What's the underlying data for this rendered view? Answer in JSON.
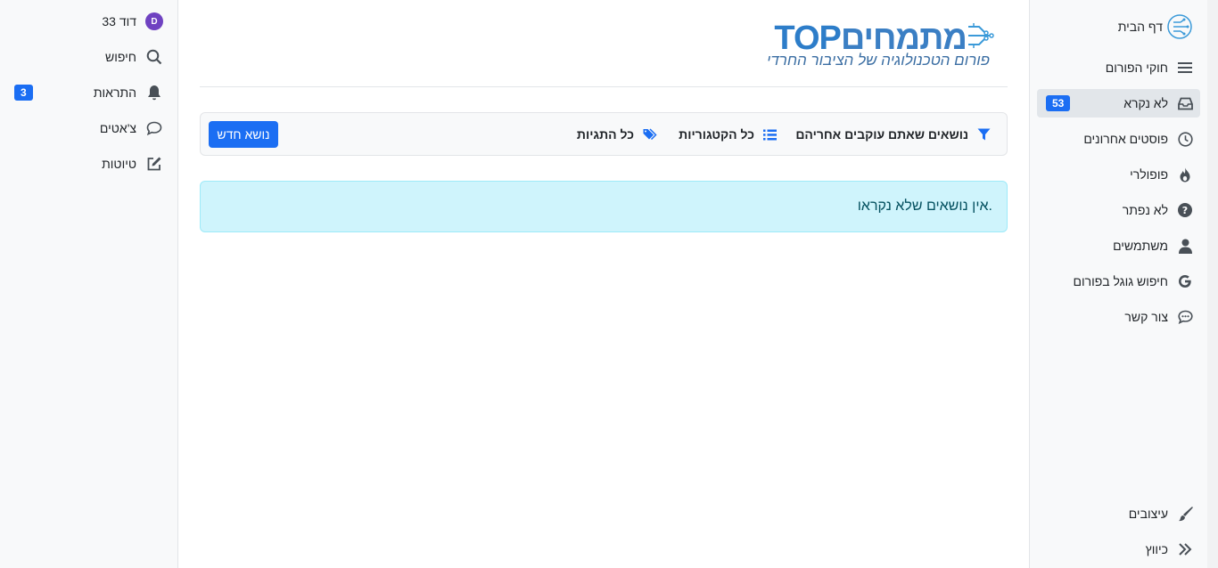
{
  "right_sidebar": {
    "items": [
      {
        "label": "דף הבית",
        "icon": "brain-circuit-icon"
      },
      {
        "label": "חוקי הפורום",
        "icon": "menu-lines-icon"
      },
      {
        "label": "לא נקרא",
        "icon": "inbox-icon",
        "badge": "53",
        "active": true
      },
      {
        "label": "פוסטים אחרונים",
        "icon": "clock-icon"
      },
      {
        "label": "פופולרי",
        "icon": "fire-icon"
      },
      {
        "label": "לא נפתר",
        "icon": "question-circle-icon"
      },
      {
        "label": "משתמשים",
        "icon": "user-icon"
      },
      {
        "label": "חיפוש גוגל בפורום",
        "icon": "google-icon"
      },
      {
        "label": "צור קשר",
        "icon": "comment-dots-icon"
      }
    ],
    "bottom": [
      {
        "label": "עיצובים",
        "icon": "paintbrush-icon"
      },
      {
        "label": "כיווץ",
        "icon": "double-chevron-right-icon"
      }
    ]
  },
  "left_sidebar": {
    "user": {
      "name": "דוד 33",
      "avatar_letter": "D",
      "avatar_color": "#6f42c1"
    },
    "items": [
      {
        "label": "חיפוש",
        "icon": "search-icon"
      },
      {
        "label": "התראות",
        "icon": "bell-icon",
        "badge": "3"
      },
      {
        "label": "צ'אטים",
        "icon": "chat-bubble-icon"
      },
      {
        "label": "טיוטות",
        "icon": "edit-icon"
      }
    ]
  },
  "logo": {
    "title_he": "מתמחים",
    "title_en": "TOP",
    "subtitle": "פורום הטכנולוגיה של הציבור החרדי"
  },
  "toolbar": {
    "filter_label": "נושאים שאתם עוקבים אחריהם",
    "categories_label": "כל הקטגוריות",
    "tags_label": "כל התגיות",
    "new_topic_label": "נושא חדש"
  },
  "alert": {
    "message": "אין נושאים שלא נקראו."
  },
  "colors": {
    "accent": "#1b6ef3",
    "alert_bg": "#cff4fc",
    "alert_text": "#055160"
  }
}
